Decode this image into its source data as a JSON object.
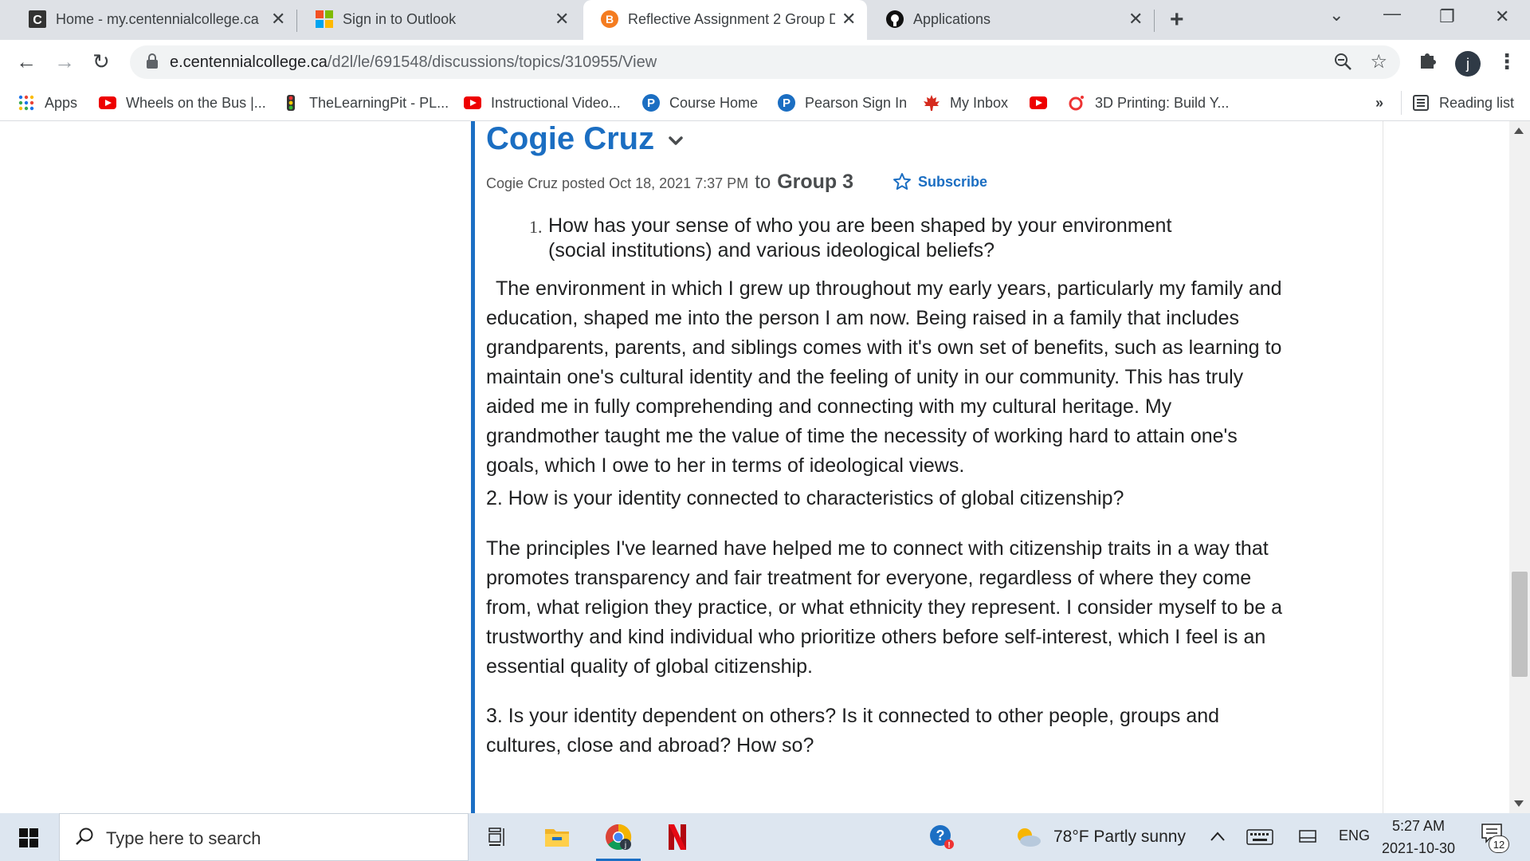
{
  "browser": {
    "tabs": [
      {
        "title": "Home - my.centennialcollege.ca",
        "icon": "centennial-c-icon",
        "active": false
      },
      {
        "title": "Sign in to Outlook",
        "icon": "microsoft-icon",
        "active": false
      },
      {
        "title": "Reflective Assignment 2 Group D",
        "icon": "brightspace-icon",
        "active": true
      },
      {
        "title": "Applications",
        "icon": "github-icon",
        "active": false
      }
    ],
    "new_tab": "+",
    "window_controls": {
      "minimize": "—",
      "restore": "❐",
      "close": "✕",
      "tab_search": "⌄"
    },
    "url_host": "e.centennialcollege.ca",
    "url_path": "/d2l/le/691548/discussions/topics/310955/View",
    "profile_initial": "j",
    "menu": "⋮"
  },
  "bookmarks": {
    "items": [
      {
        "label": "Apps",
        "icon": "apps-grid-icon"
      },
      {
        "label": "Wheels on the Bus |...",
        "icon": "youtube-icon"
      },
      {
        "label": "TheLearningPit - PL...",
        "icon": "traffic-light-icon"
      },
      {
        "label": "Instructional Video...",
        "icon": "youtube-icon"
      },
      {
        "label": "Course Home",
        "icon": "pearson-icon"
      },
      {
        "label": "Pearson Sign In",
        "icon": "pearson-icon"
      },
      {
        "label": "My Inbox",
        "icon": "maple-leaf-icon"
      },
      {
        "label": "",
        "icon": "youtube-icon"
      },
      {
        "label": "3D Printing: Build Y...",
        "icon": "ring-icon"
      }
    ],
    "overflow": "»",
    "reading_list": "Reading list"
  },
  "post": {
    "title": "Cogie Cruz",
    "author_line": "Cogie Cruz posted Oct 18, 2021 7:37 PM",
    "to": "to",
    "group": "Group 3",
    "subscribe": "Subscribe",
    "q1_number": "1.",
    "q1": "How has your sense of who you are been shaped by your environment (social institutions) and various ideological beliefs?",
    "a1": "The environment in which I grew up throughout my early years, particularly my family and education, shaped me into the person I am now. Being raised in a family that includes grandparents, parents, and siblings comes with it's own set of benefits, such as learning to maintain one's cultural identity and the feeling of unity in our community. This has truly aided me in fully comprehending and connecting with my cultural heritage. My grandmother taught me the value of time the necessity of working hard to attain one's goals, which I owe to her in terms of ideological views.",
    "q2": "2. How is your identity connected to characteristics of global citizenship?",
    "a2": "The principles I've learned have helped me to connect with citizenship traits in a way that promotes transparency and fair treatment for everyone, regardless of where they come from, what religion they practice, or what ethnicity they represent. I consider myself to be a trustworthy and kind individual who prioritize others before self-interest, which I feel is an essential quality of global citizenship.",
    "q3": "3.  Is your identity dependent on others? Is it connected to other people, groups and cultures, close and abroad? How so?"
  },
  "taskbar": {
    "search_placeholder": "Type here to search",
    "apps": [
      "task-view-icon",
      "file-explorer-icon",
      "chrome-icon",
      "netflix-icon"
    ],
    "weather": "78°F  Partly sunny",
    "language": "ENG",
    "time": "5:27 AM",
    "date": "2021-10-30",
    "notifications": "12"
  },
  "colors": {
    "accent": "#1b6ec2",
    "rule": "#1c6fc4",
    "tabstrip": "#dee1e6",
    "taskbar": "#dde6f0"
  }
}
